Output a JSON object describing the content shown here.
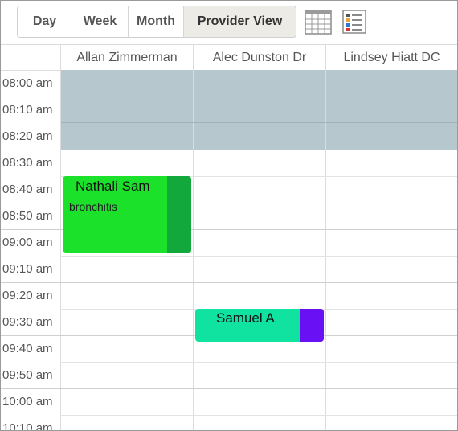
{
  "toolbar": {
    "views": [
      {
        "label": "Day"
      },
      {
        "label": "Week"
      },
      {
        "label": "Month"
      },
      {
        "label": "Provider View",
        "active": true
      }
    ],
    "icons": [
      "calendar-grid-icon",
      "list-view-icon"
    ]
  },
  "providers": [
    {
      "name": "Allan Zimmerman"
    },
    {
      "name": "Alec Dunston Dr"
    },
    {
      "name": "Lindsey Hiatt DC"
    }
  ],
  "time_slots": [
    "08:00 am",
    "08:10 am",
    "08:20 am",
    "08:30 am",
    "08:40 am",
    "08:50 am",
    "09:00 am",
    "09:10 am",
    "09:20 am",
    "09:30 am",
    "09:40 am",
    "09:50 am",
    "10:00 am",
    "10:10 am"
  ],
  "appointments": [
    {
      "provider": "Allan Zimmerman",
      "patient": "Nathali Sam",
      "reason": "bronchitis",
      "color": "#1ce12a",
      "status_color": "#12a83c"
    },
    {
      "provider": "Alec Dunston Dr",
      "patient": "Samuel A",
      "reason": "",
      "color": "#10e3a0",
      "status_color": "#6a10f5"
    }
  ],
  "colors": {
    "blocked": "#b6c8cd",
    "active_view_bg": "#ecebe6"
  }
}
